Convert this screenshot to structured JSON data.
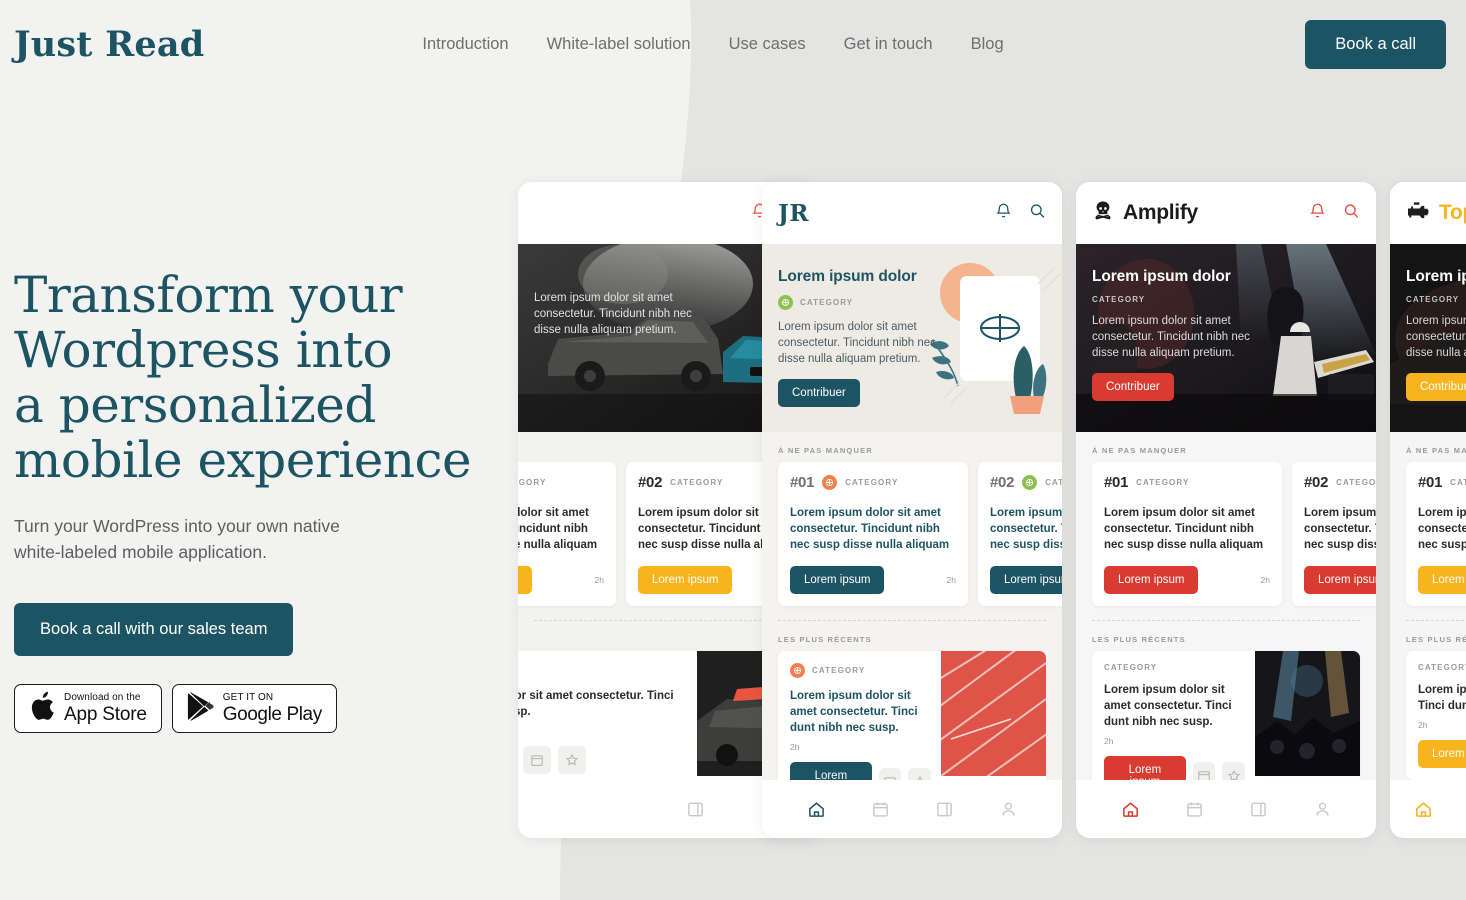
{
  "brand": {
    "logo": "Just Read"
  },
  "nav": {
    "items": [
      {
        "label": "Introduction"
      },
      {
        "label": "White-label solution"
      },
      {
        "label": "Use cases"
      },
      {
        "label": "Get in touch"
      },
      {
        "label": "Blog"
      }
    ],
    "cta": "Book a call"
  },
  "hero": {
    "title_lines": [
      "Transform your",
      "Wordpress into",
      "a personalized",
      "mobile experience"
    ],
    "subtitle": "Turn your WordPress into your own native white-labeled mobile application.",
    "cta": "Book a call with our sales team",
    "badges": [
      {
        "small": "Download on the",
        "big": "App Store",
        "icon": "apple-icon"
      },
      {
        "small": "GET IT ON",
        "big": "Google Play",
        "icon": "google-play-icon"
      }
    ]
  },
  "colors": {
    "teal": "#1d5464",
    "page_bg": "#f2f2f1",
    "panel_bg": "#e4e4e3",
    "amber": "#f7b41c",
    "red": "#d93b30",
    "coral": "#f4804f",
    "green": "#8cc152"
  },
  "labels": {
    "section_featured": "À NE PAS MANQUER",
    "section_recent": "LES PLUS RÉCENTS",
    "category": "CATEGORY",
    "time": "2h",
    "card_btn": "Lorem ipsum",
    "hero_btn": "Contribuer",
    "hero_title": "Lorem ipsum dolor",
    "hero_body": "Lorem ipsum dolor sit amet consectetur. Tincidunt nibh nec disse nulla aliquam pretium.",
    "card_title": "Lorem ipsum dolor sit amet consectetur. Tincidunt nibh nec susp disse nulla aliquam",
    "recent_title": "Lorem ipsum dolor sit amet consectetur. Tinci dunt nibh nec susp.",
    "rank1": "#01",
    "rank2": "#02"
  },
  "phones": [
    {
      "id": "phone-racing",
      "brand": "",
      "brand_type": "none",
      "accent": "#f7b41c",
      "hero_style": "photo-dark",
      "hero_title_color": "#ffffff",
      "hero_body_color": "#e2e2e2",
      "icon_color": "#e8563f",
      "bg": "#f2f2f1",
      "nav_active": "#f7b41c"
    },
    {
      "id": "phone-jr",
      "brand": "JR",
      "brand_type": "serif",
      "brand_color": "#1d5464",
      "accent": "#1d5464",
      "hero_style": "illustration",
      "hero_title_color": "#1d5464",
      "hero_body_color": "#4b5c61",
      "icon_color": "#1d5464",
      "bg": "#f4f3f0",
      "nav_active": "#1d5464"
    },
    {
      "id": "phone-amplify",
      "brand": "Amplify",
      "brand_type": "sans",
      "brand_color": "#1c1c1c",
      "accent": "#d93b30",
      "hero_style": "photo-concert",
      "hero_title_color": "#ffffff",
      "hero_body_color": "#dcdcdc",
      "icon_color": "#e8483a",
      "bg": "#f6f6f6",
      "nav_active": "#d93b30"
    },
    {
      "id": "phone-top",
      "brand": "Top",
      "brand_type": "sans",
      "brand_color": "#f7b41c",
      "accent": "#f7b41c",
      "hero_style": "photo-black",
      "hero_title_color": "#ffffff",
      "hero_body_color": "#d8d8d8",
      "icon_color": "#f7b41c",
      "bg": "#f5f5f5",
      "nav_active": "#f7b41c"
    }
  ],
  "phone_nav": [
    {
      "icon": "home-icon"
    },
    {
      "icon": "calendar-icon"
    },
    {
      "icon": "book-icon"
    },
    {
      "icon": "person-icon"
    }
  ]
}
